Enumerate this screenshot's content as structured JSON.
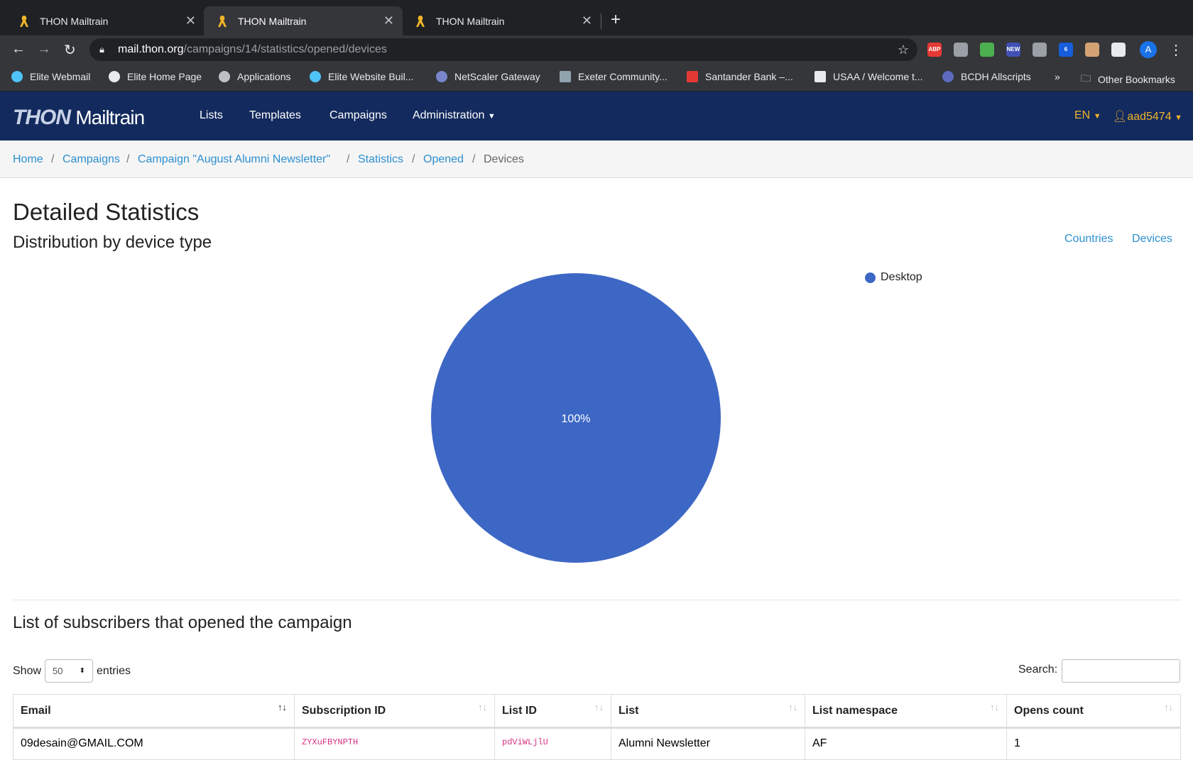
{
  "browser": {
    "tabs": [
      {
        "title": "THON Mailtrain"
      },
      {
        "title": "THON Mailtrain"
      },
      {
        "title": "THON Mailtrain"
      }
    ],
    "url_host": "mail.thon.org",
    "url_path": "/campaigns/14/statistics/opened/devices",
    "extensions": [
      {
        "icon": "adblock-plus-icon",
        "label": "ABP",
        "color": "#e53935"
      },
      {
        "icon": "office-icon",
        "color": "#9aa0a6"
      },
      {
        "icon": "color-wheel-icon",
        "color": "#4caf50"
      },
      {
        "icon": "new-badge-icon",
        "label": "NEW",
        "color": "#3f51b5"
      },
      {
        "icon": "extension-gray-icon",
        "color": "#9aa0a6"
      },
      {
        "icon": "bitwarden-icon",
        "label": "6",
        "color": "#175ddc"
      },
      {
        "icon": "cookie-icon",
        "color": "#d4a373"
      },
      {
        "icon": "puzzle-icon",
        "color": "#e8eaed"
      }
    ],
    "profile_initial": "A",
    "bookmarks": [
      {
        "label": "Elite Webmail"
      },
      {
        "label": "Elite Home Page"
      },
      {
        "label": "Applications"
      },
      {
        "label": "Elite Website Buil..."
      },
      {
        "label": "NetScaler Gateway"
      },
      {
        "label": "Exeter Community..."
      },
      {
        "label": "Santander Bank –..."
      },
      {
        "label": "USAA / Welcome t..."
      },
      {
        "label": "BCDH Allscripts"
      }
    ],
    "more_bookmarks": "»",
    "other_bookmarks": "Other Bookmarks"
  },
  "app": {
    "logo_thon": "THON",
    "logo_mailtrain": "Mailtrain",
    "nav": [
      "Lists",
      "Templates",
      "Campaigns",
      "Administration"
    ],
    "language": "EN",
    "user": "aad5474"
  },
  "breadcrumb": [
    "Home",
    "Campaigns",
    "Campaign \"August Alumni Newsletter\"",
    "Statistics",
    "Opened",
    "Devices"
  ],
  "page": {
    "title": "Detailed Statistics",
    "subtitle": "Distribution by device type",
    "links": [
      "Countries",
      "Devices"
    ]
  },
  "chart_data": {
    "type": "pie",
    "title": "",
    "categories": [
      "Desktop"
    ],
    "values": [
      100
    ],
    "labels": [
      "100%"
    ],
    "colors": [
      "#3d67c5"
    ],
    "legend_position": "top-right"
  },
  "table_section": {
    "heading": "List of subscribers that opened the campaign",
    "show_label": "Show",
    "entries_value": "50",
    "entries_label": "entries",
    "search_label": "Search:",
    "columns": [
      "Email",
      "Subscription ID",
      "List ID",
      "List",
      "List namespace",
      "Opens count"
    ],
    "rows": [
      [
        "09desain@GMAIL.COM",
        "ZYXuFBYNPTH",
        "pdViWLjlU",
        "Alumni Newsletter",
        "AF",
        "1"
      ]
    ]
  }
}
